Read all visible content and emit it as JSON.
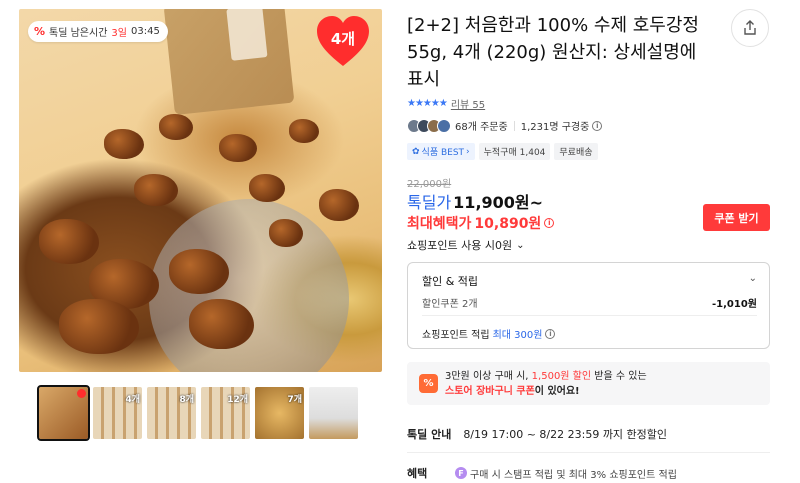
{
  "timer": {
    "label": "톡딜 남은시간",
    "days": "3일",
    "time": "03:45"
  },
  "hero_badge": {
    "count": "4개"
  },
  "thumbnails": [
    {
      "count": ""
    },
    {
      "count": "4개"
    },
    {
      "count": "8개"
    },
    {
      "count": "12개"
    },
    {
      "count": "7개"
    },
    {
      "count": ""
    }
  ],
  "product": {
    "title": "[2+2] 처음한과 100% 수제 호두강정 55g, 4개 (220g) 원산지: 상세설명에 표시",
    "stars": "★★★★★",
    "review_label": "리뷰 55",
    "orders": "68개 주문중",
    "subscribers": "1,231명 구경중"
  },
  "tags": [
    {
      "label": "식품 BEST",
      "kind": "best"
    },
    {
      "label": "누적구매 1,404",
      "kind": "normal"
    },
    {
      "label": "무료배송",
      "kind": "normal"
    }
  ],
  "price": {
    "original": "22,000원",
    "deal_label": "톡딜가",
    "deal_value": "11,900원~",
    "max_label": "최대혜택가",
    "max_value": "10,890원",
    "coupon_button": "쿠폰 받기",
    "points_use": "쇼핑포인트 사용 시0원"
  },
  "discount": {
    "header": "할인 & 적립",
    "coupon_label": "할인쿠폰 2개",
    "coupon_value": "-1,010원",
    "point_prefix": "쇼핑포인트 적립",
    "point_value": "최대 300원"
  },
  "cart_banner": {
    "icon": "%",
    "line1_a": "3만원 이상 구매 시,",
    "line1_b": "1,500원 할인",
    "line1_c": "받을 수 있는",
    "line2_a": "스토어 장바구니 쿠폰",
    "line2_b": "이 있어요!"
  },
  "deal_info": {
    "label": "톡딜 안내",
    "value": "8/19 17:00 ~ 8/22 23:59 까지 한정할인"
  },
  "benefit": {
    "label": "혜택",
    "icon": "F",
    "value": "구매 시 스탬프 적립 및 최대 3% 쇼핑포인트 적립"
  },
  "colors": {
    "accent_red": "#ff3a3a",
    "accent_blue": "#2a67e8",
    "star_blue": "#3b78f5"
  }
}
